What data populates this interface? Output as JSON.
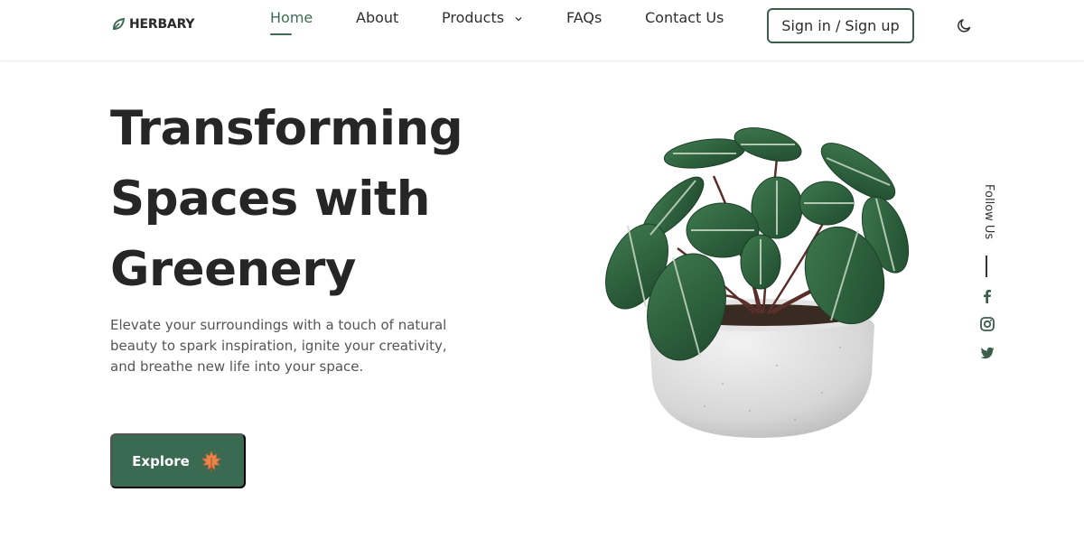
{
  "brand": {
    "name": "HERBARY",
    "icon": "leaf-icon"
  },
  "nav": {
    "items": [
      {
        "label": "Home",
        "active": true
      },
      {
        "label": "About"
      },
      {
        "label": "Products",
        "icon": "chevron-down-icon"
      },
      {
        "label": "FAQs"
      },
      {
        "label": "Contact Us"
      }
    ],
    "signin_label": "Sign in / Sign up",
    "theme_icon": "moon-icon"
  },
  "hero": {
    "title_lines": [
      "Transforming",
      "Spaces with",
      "Greenery"
    ],
    "description": "Elevate your surroundings with a touch of natural beauty to spark inspiration, ignite your creativity, and breathe new life into your space.",
    "cta_label": "Explore",
    "cta_icon": "maple-leaf-icon"
  },
  "social": {
    "label": "Follow Us",
    "icons": [
      "facebook-icon",
      "instagram-icon",
      "twitter-icon"
    ]
  },
  "colors": {
    "accent": "#3b6a52",
    "text": "#262626",
    "leaf_orange": "#e8854a"
  }
}
